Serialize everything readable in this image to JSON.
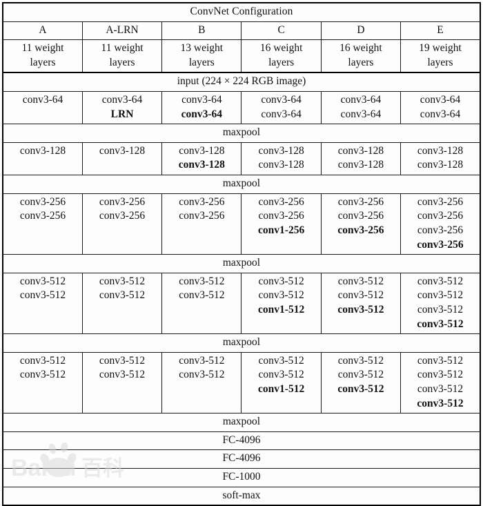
{
  "table": {
    "title": "ConvNet Configuration",
    "columns": [
      {
        "name": "A",
        "depth": "11 weight\nlayers"
      },
      {
        "name": "A-LRN",
        "depth": "11 weight\nlayers"
      },
      {
        "name": "B",
        "depth": "13 weight\nlayers"
      },
      {
        "name": "C",
        "depth": "16 weight\nlayers"
      },
      {
        "name": "D",
        "depth": "16 weight\nlayers"
      },
      {
        "name": "E",
        "depth": "19 weight\nlayers"
      }
    ],
    "input_row": "input (224 × 224 RGB image)",
    "maxpool_label": "maxpool",
    "blocks": [
      {
        "id": "conv64",
        "cells": [
          [
            {
              "text": "conv3-64",
              "bold": false
            }
          ],
          [
            {
              "text": "conv3-64",
              "bold": false
            },
            {
              "text": "LRN",
              "bold": true
            }
          ],
          [
            {
              "text": "conv3-64",
              "bold": false
            },
            {
              "text": "conv3-64",
              "bold": true
            }
          ],
          [
            {
              "text": "conv3-64",
              "bold": false
            },
            {
              "text": "conv3-64",
              "bold": false
            }
          ],
          [
            {
              "text": "conv3-64",
              "bold": false
            },
            {
              "text": "conv3-64",
              "bold": false
            }
          ],
          [
            {
              "text": "conv3-64",
              "bold": false
            },
            {
              "text": "conv3-64",
              "bold": false
            }
          ]
        ],
        "lines": 2
      },
      {
        "id": "conv128",
        "cells": [
          [
            {
              "text": "conv3-128",
              "bold": false
            }
          ],
          [
            {
              "text": "conv3-128",
              "bold": false
            }
          ],
          [
            {
              "text": "conv3-128",
              "bold": false
            },
            {
              "text": "conv3-128",
              "bold": true
            }
          ],
          [
            {
              "text": "conv3-128",
              "bold": false
            },
            {
              "text": "conv3-128",
              "bold": false
            }
          ],
          [
            {
              "text": "conv3-128",
              "bold": false
            },
            {
              "text": "conv3-128",
              "bold": false
            }
          ],
          [
            {
              "text": "conv3-128",
              "bold": false
            },
            {
              "text": "conv3-128",
              "bold": false
            }
          ]
        ],
        "lines": 2
      },
      {
        "id": "conv256",
        "cells": [
          [
            {
              "text": "conv3-256",
              "bold": false
            },
            {
              "text": "conv3-256",
              "bold": false
            }
          ],
          [
            {
              "text": "conv3-256",
              "bold": false
            },
            {
              "text": "conv3-256",
              "bold": false
            }
          ],
          [
            {
              "text": "conv3-256",
              "bold": false
            },
            {
              "text": "conv3-256",
              "bold": false
            }
          ],
          [
            {
              "text": "conv3-256",
              "bold": false
            },
            {
              "text": "conv3-256",
              "bold": false
            },
            {
              "text": "conv1-256",
              "bold": true
            }
          ],
          [
            {
              "text": "conv3-256",
              "bold": false
            },
            {
              "text": "conv3-256",
              "bold": false
            },
            {
              "text": "conv3-256",
              "bold": true
            }
          ],
          [
            {
              "text": "conv3-256",
              "bold": false
            },
            {
              "text": "conv3-256",
              "bold": false
            },
            {
              "text": "conv3-256",
              "bold": false
            },
            {
              "text": "conv3-256",
              "bold": true
            }
          ]
        ],
        "lines": 4
      },
      {
        "id": "conv512a",
        "cells": [
          [
            {
              "text": "conv3-512",
              "bold": false
            },
            {
              "text": "conv3-512",
              "bold": false
            }
          ],
          [
            {
              "text": "conv3-512",
              "bold": false
            },
            {
              "text": "conv3-512",
              "bold": false
            }
          ],
          [
            {
              "text": "conv3-512",
              "bold": false
            },
            {
              "text": "conv3-512",
              "bold": false
            }
          ],
          [
            {
              "text": "conv3-512",
              "bold": false
            },
            {
              "text": "conv3-512",
              "bold": false
            },
            {
              "text": "conv1-512",
              "bold": true
            }
          ],
          [
            {
              "text": "conv3-512",
              "bold": false
            },
            {
              "text": "conv3-512",
              "bold": false
            },
            {
              "text": "conv3-512",
              "bold": true
            }
          ],
          [
            {
              "text": "conv3-512",
              "bold": false
            },
            {
              "text": "conv3-512",
              "bold": false
            },
            {
              "text": "conv3-512",
              "bold": false
            },
            {
              "text": "conv3-512",
              "bold": true
            }
          ]
        ],
        "lines": 4
      },
      {
        "id": "conv512b",
        "cells": [
          [
            {
              "text": "conv3-512",
              "bold": false
            },
            {
              "text": "conv3-512",
              "bold": false
            }
          ],
          [
            {
              "text": "conv3-512",
              "bold": false
            },
            {
              "text": "conv3-512",
              "bold": false
            }
          ],
          [
            {
              "text": "conv3-512",
              "bold": false
            },
            {
              "text": "conv3-512",
              "bold": false
            }
          ],
          [
            {
              "text": "conv3-512",
              "bold": false
            },
            {
              "text": "conv3-512",
              "bold": false
            },
            {
              "text": "conv1-512",
              "bold": true
            }
          ],
          [
            {
              "text": "conv3-512",
              "bold": false
            },
            {
              "text": "conv3-512",
              "bold": false
            },
            {
              "text": "conv3-512",
              "bold": true
            }
          ],
          [
            {
              "text": "conv3-512",
              "bold": false
            },
            {
              "text": "conv3-512",
              "bold": false
            },
            {
              "text": "conv3-512",
              "bold": false
            },
            {
              "text": "conv3-512",
              "bold": true
            }
          ]
        ],
        "lines": 4
      }
    ],
    "classifier_rows": [
      "FC-4096",
      "FC-4096",
      "FC-1000",
      "soft-max"
    ]
  },
  "watermark": {
    "text": "Bai du 百科",
    "color": "#d9d9d9"
  },
  "colors": {
    "border": "#1a1a1a",
    "text": "#111111",
    "background": "#ffffff",
    "cell_background": "#fdfdfd"
  }
}
